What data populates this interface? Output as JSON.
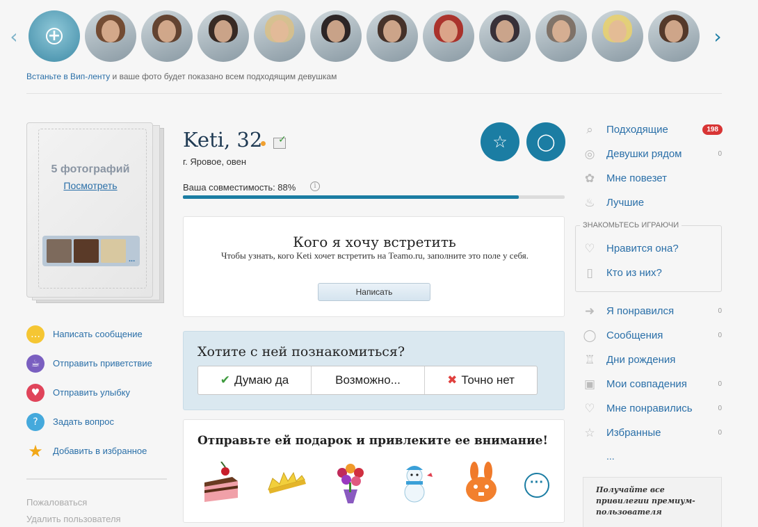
{
  "carousel": {
    "prev_icon": "chevron-left-icon",
    "next_icon": "chevron-right-icon",
    "add_icon": "plus-icon",
    "avatars": [
      {
        "hair": "#6b3f24"
      },
      {
        "hair": "#5a3520"
      },
      {
        "hair": "#2a1a12"
      },
      {
        "hair": "#d8c08a"
      },
      {
        "hair": "#1e1414"
      },
      {
        "hair": "#3a2218"
      },
      {
        "hair": "#a8241c"
      },
      {
        "hair": "#2a2028"
      },
      {
        "hair": "#7a6a5e"
      },
      {
        "hair": "#e8d070"
      },
      {
        "hair": "#4a2a18"
      }
    ]
  },
  "vip": {
    "link": "Встаньте в Вип-ленту",
    "text": " и ваше фото будет показано всем подходящим девушкам"
  },
  "album": {
    "title": "5 фотографий",
    "view_label": "Посмотреть",
    "more": "..."
  },
  "actions": [
    {
      "label": "Написать сообщение",
      "icon": "chat-bubble-icon",
      "color": "#f5c633"
    },
    {
      "label": "Отправить приветствие",
      "icon": "coffee-cup-icon",
      "color": "#7a5fc0"
    },
    {
      "label": "Отправить улыбку",
      "icon": "smile-heart-icon",
      "color": "#e0445a"
    },
    {
      "label": "Задать вопрос",
      "icon": "question-icon",
      "color": "#45a9dc"
    },
    {
      "label": "Добавить в избранное",
      "icon": "star-icon",
      "color": "#f2a818"
    }
  ],
  "report_label": "Пожаловаться",
  "delete_label": "Удалить пользователя",
  "profile": {
    "name": "Keti, 32",
    "location": "г. Яровое, овен",
    "compat_label": "Ваша совместимость: 88%",
    "compat_value": 0.88,
    "favorite_icon": "star-outline-icon",
    "message_icon": "speech-bubble-icon"
  },
  "wish": {
    "title": "Кого я хочу встретить",
    "text": "Чтобы узнать, кого Keti хочет встретить на Teamo.ru, заполните это поле у себя.",
    "button": "Написать"
  },
  "meet": {
    "title": "Хотите с ней познакомиться?",
    "yes": "Думаю да",
    "maybe": "Возможно...",
    "no": "Точно нет"
  },
  "gifts": {
    "title": "Отправьте ей подарок и привлеките ее внимание!",
    "items": [
      "cake-slice-icon",
      "crown-icon",
      "flower-bouquet-icon",
      "snowman-icon",
      "bunny-toy-icon"
    ],
    "more": "···"
  },
  "nav": {
    "main": [
      {
        "label": "Подходящие",
        "icon": "search-icon",
        "count": "198",
        "badge": true
      },
      {
        "label": "Девушки рядом",
        "icon": "target-icon",
        "count": "0"
      },
      {
        "label": "Мне повезет",
        "icon": "clover-icon",
        "count": ""
      },
      {
        "label": "Лучшие",
        "icon": "flame-icon",
        "count": ""
      }
    ],
    "games_caption": "ЗНАКОМЬТЕСЬ ИГРАЮЧИ",
    "games": [
      {
        "label": "Нравится она?",
        "icon": "heart-outline-icon"
      },
      {
        "label": "Кто из них?",
        "icon": "cards-icon"
      }
    ],
    "secondary": [
      {
        "label": "Я понравился",
        "icon": "heart-arrow-icon",
        "count": "0"
      },
      {
        "label": "Сообщения",
        "icon": "speech-bubble-icon",
        "count": "0"
      },
      {
        "label": "Дни рождения",
        "icon": "birthday-cake-icon",
        "count": ""
      },
      {
        "label": "Мои совпадения",
        "icon": "match-card-icon",
        "count": "0"
      },
      {
        "label": "Мне понравились",
        "icon": "heart-check-icon",
        "count": "0"
      },
      {
        "label": "Избранные",
        "icon": "star-outline-icon",
        "count": "0"
      }
    ],
    "more": "..."
  },
  "premium": {
    "text": "Получайте все привилегии премиум-пользователя"
  }
}
